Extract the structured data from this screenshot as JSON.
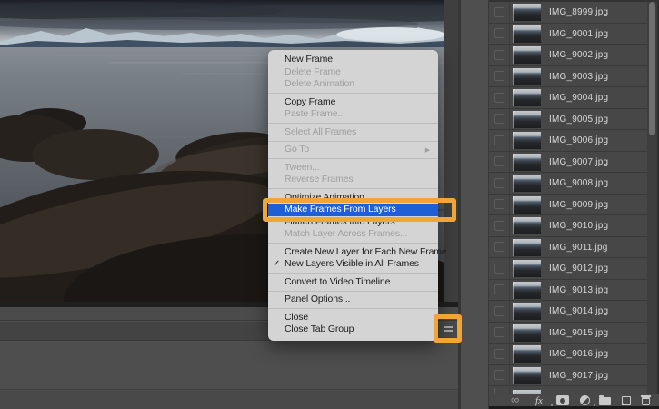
{
  "annotation": {
    "highlight_color": "#efa636"
  },
  "menu": {
    "selection_color": "#1e5fd6",
    "items": [
      {
        "label": "New Frame"
      },
      {
        "label": "Delete Frame",
        "state": "disabled"
      },
      {
        "label": "Delete Animation",
        "state": "disabled"
      },
      {
        "type": "separator"
      },
      {
        "label": "Copy Frame"
      },
      {
        "label": "Paste Frame...",
        "state": "disabled"
      },
      {
        "type": "separator"
      },
      {
        "label": "Select All Frames",
        "state": "disabled"
      },
      {
        "type": "separator"
      },
      {
        "label": "Go To",
        "state": "disabled",
        "submenu": true
      },
      {
        "type": "separator"
      },
      {
        "label": "Tween...",
        "state": "disabled"
      },
      {
        "label": "Reverse Frames",
        "state": "disabled"
      },
      {
        "type": "separator"
      },
      {
        "label": "Optimize Animation..."
      },
      {
        "label": "Make Frames From Layers",
        "highlighted": true
      },
      {
        "label": "Flatten Frames Into Layers"
      },
      {
        "label": "Match Layer Across Frames...",
        "state": "disabled"
      },
      {
        "type": "separator"
      },
      {
        "label": "Create New Layer for Each New Frame"
      },
      {
        "label": "New Layers Visible in All Frames",
        "checked": true
      },
      {
        "type": "separator"
      },
      {
        "label": "Convert to Video Timeline"
      },
      {
        "type": "separator"
      },
      {
        "label": "Panel Options..."
      },
      {
        "type": "separator"
      },
      {
        "label": "Close"
      },
      {
        "label": "Close Tab Group"
      }
    ]
  },
  "layers_panel": {
    "layers": [
      "IMG_8999.jpg",
      "IMG_9001.jpg",
      "IMG_9002.jpg",
      "IMG_9003.jpg",
      "IMG_9004.jpg",
      "IMG_9005.jpg",
      "IMG_9006.jpg",
      "IMG_9007.jpg",
      "IMG_9008.jpg",
      "IMG_9009.jpg",
      "IMG_9010.jpg",
      "IMG_9011.jpg",
      "IMG_9012.jpg",
      "IMG_9013.jpg",
      "IMG_9014.jpg",
      "IMG_9015.jpg",
      "IMG_9016.jpg",
      "IMG_9017.jpg"
    ],
    "toolbar_icons": [
      "link",
      "fx",
      "layer-mask",
      "adjustment",
      "group",
      "new-layer",
      "delete"
    ]
  }
}
